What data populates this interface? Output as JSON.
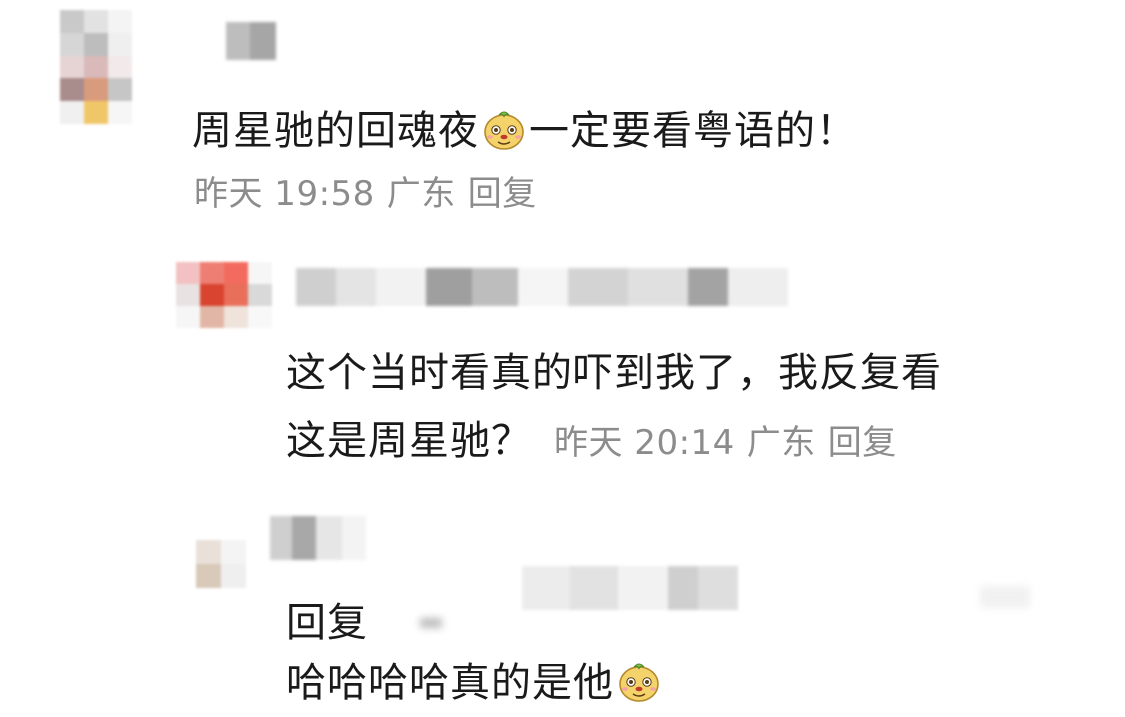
{
  "comment": {
    "text_before_emoji": "周星驰的回魂夜",
    "emoji": "melon-face-emoji",
    "text_after_emoji": "一定要看粤语的！",
    "time": "昨天 19:58",
    "location": "广东",
    "reply_label": "回复"
  },
  "reply1": {
    "line1": "这个当时看真的吓到我了，我反复看",
    "line2": "这是周星驰？",
    "time": "昨天 20:14",
    "location": "广东",
    "reply_label": "回复"
  },
  "reply2": {
    "line1": "回复",
    "line2_text": "哈哈哈哈真的是他",
    "emoji": "melon-face-emoji"
  },
  "colors": {
    "text": "#1a1a1a",
    "meta": "#8c8c8c",
    "background": "#ffffff",
    "emoji_body": "#f3d36a",
    "emoji_leaf": "#7fbf4d"
  }
}
